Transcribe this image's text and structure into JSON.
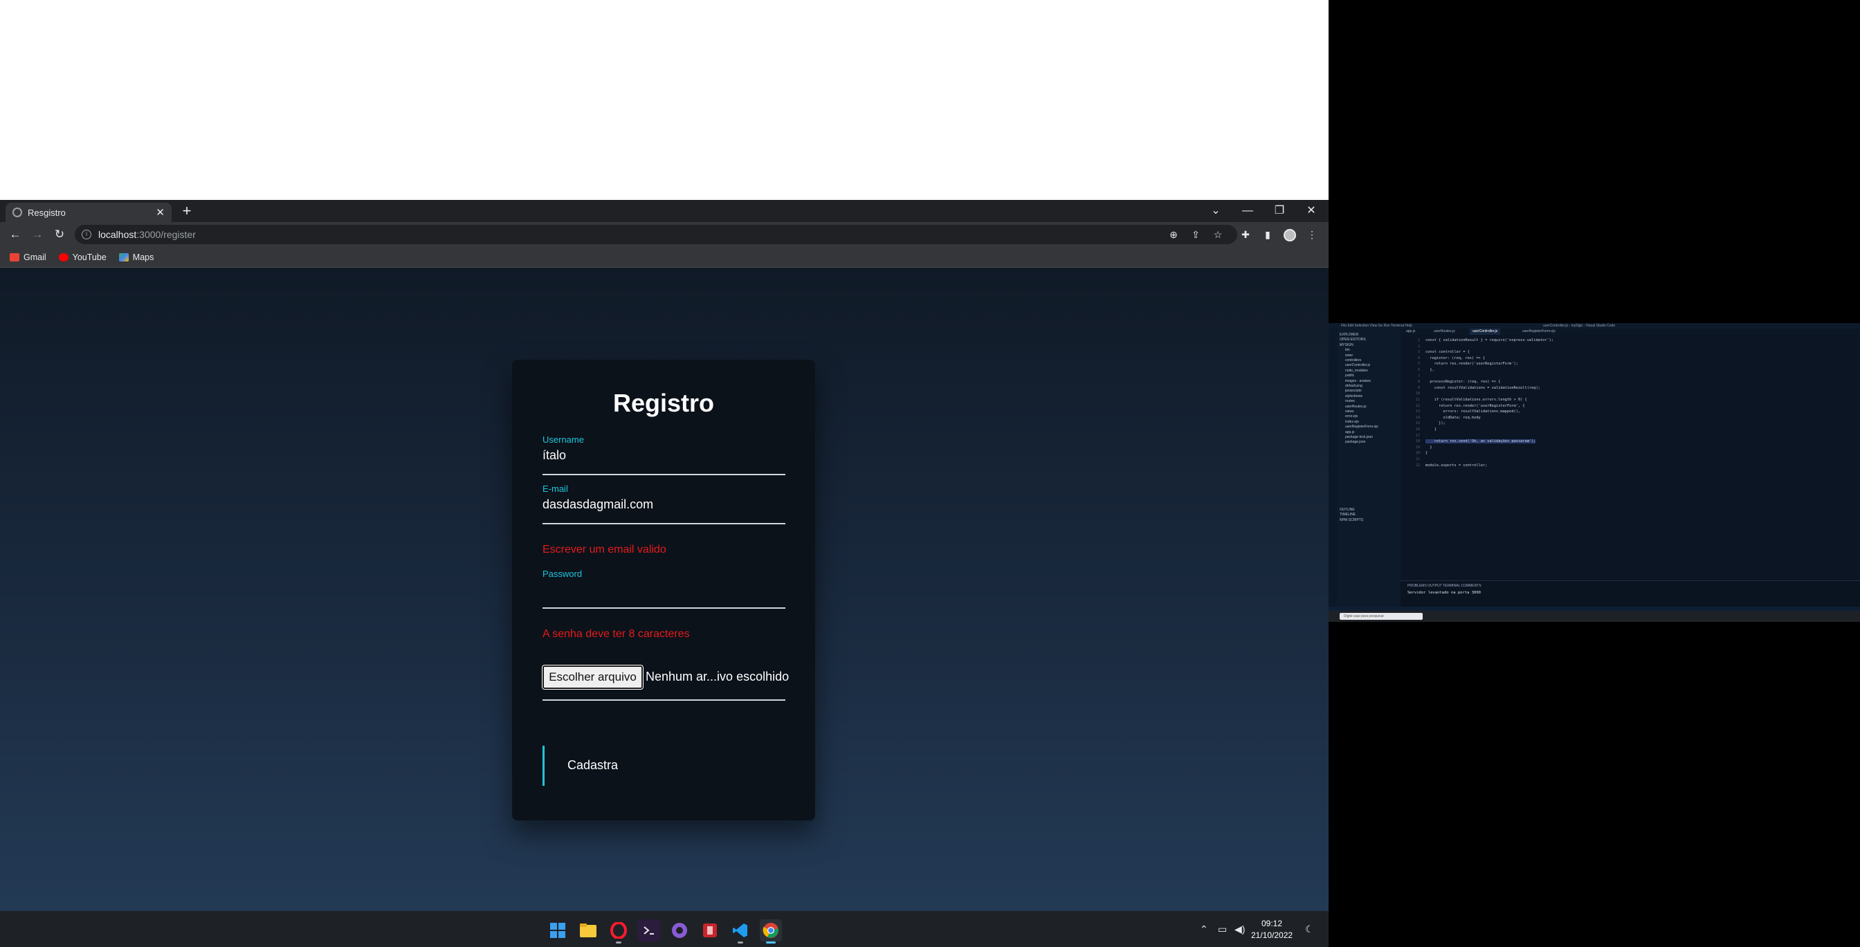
{
  "browser": {
    "tab_title": "Resgistro",
    "tab_close": "✕",
    "new_tab": "+",
    "window_controls": [
      "⌄",
      "—",
      "❐",
      "✕"
    ],
    "nav": {
      "back": "←",
      "forward": "→",
      "reload": "↻"
    },
    "url_host": "localhost",
    "url_path": ":3000/register",
    "toolbar_icons": [
      "zoom-icon",
      "share-icon",
      "star-icon",
      "extensions-icon",
      "sidepanel-icon",
      "profile-avatar",
      "menu-icon"
    ],
    "bookmarks": [
      {
        "label": "Gmail",
        "color": "#ea4335"
      },
      {
        "label": "YouTube",
        "color": "#ff0000"
      },
      {
        "label": "Maps",
        "color": "#34a853"
      }
    ]
  },
  "form": {
    "title": "Registro",
    "username_label": "Username",
    "username_value": "ítalo",
    "email_label": "E-mail",
    "email_value": "dasdasdagmail.com",
    "email_error": "Escrever um email valido",
    "password_label": "Password",
    "password_error": "A senha deve ter 8 caracteres",
    "file_button": "Escolher arquivo",
    "file_status": "Nenhum ar...ivo escolhido",
    "submit": "Cadastra"
  },
  "taskbar": {
    "apps": [
      "windows-start",
      "file-explorer",
      "opera",
      "terminal",
      "github-desktop",
      "app-red",
      "vscode",
      "chrome"
    ],
    "time": "09:12",
    "date": "21/10/2022"
  },
  "vscode": {
    "title": "userController.js - mySign - Visual Studio Code",
    "menu": "File  Edit  Selection  View  Go  Run  Terminal  Help",
    "tabs": [
      "app.js",
      "userRoutes.js",
      "userController.js",
      "userRegisterForm.ejs"
    ],
    "explorer": [
      "EXPLORER",
      "OPEN EDITORS",
      "MYSIGN",
      "bin",
      "www",
      "controllers",
      "userController.js",
      "node_modules",
      "public",
      "images - avatars",
      "default.png",
      "javascripts",
      "stylesheets",
      "routes",
      "userRoutes.js",
      "views",
      "error.ejs",
      "index.ejs",
      "userRegisterForm.ejs",
      "app.js",
      "package-lock.json",
      "package.json",
      "OUTLINE",
      "TIMELINE",
      "NPM SCRIPTS"
    ],
    "code": [
      "const { validationResult } = require('express-validator');",
      "",
      "const controller = {",
      "  register: (req, res) => {",
      "    return res.render('userRegisterForm');",
      "  },",
      "",
      "  processRegister: (req, res) => {",
      "    const resultValidations = validationResult(req);",
      "",
      "    if (resultValidations.errors.length > 0) {",
      "      return res.render('userRegisterForm', {",
      "        errors: resultValidations.mapped(),",
      "        oldData: req.body",
      "      });",
      "    }",
      "",
      "    return res.send('Ok, as validações passaram');",
      "  }",
      "}",
      "",
      "module.exports = controller;"
    ],
    "panel_tabs": "PROBLEMS   OUTPUT   TERMINAL   COMMENTS",
    "terminal_line": "Servidor levantado na porta 3000",
    "search_placeholder": "Digite aqui para pesquisar"
  }
}
